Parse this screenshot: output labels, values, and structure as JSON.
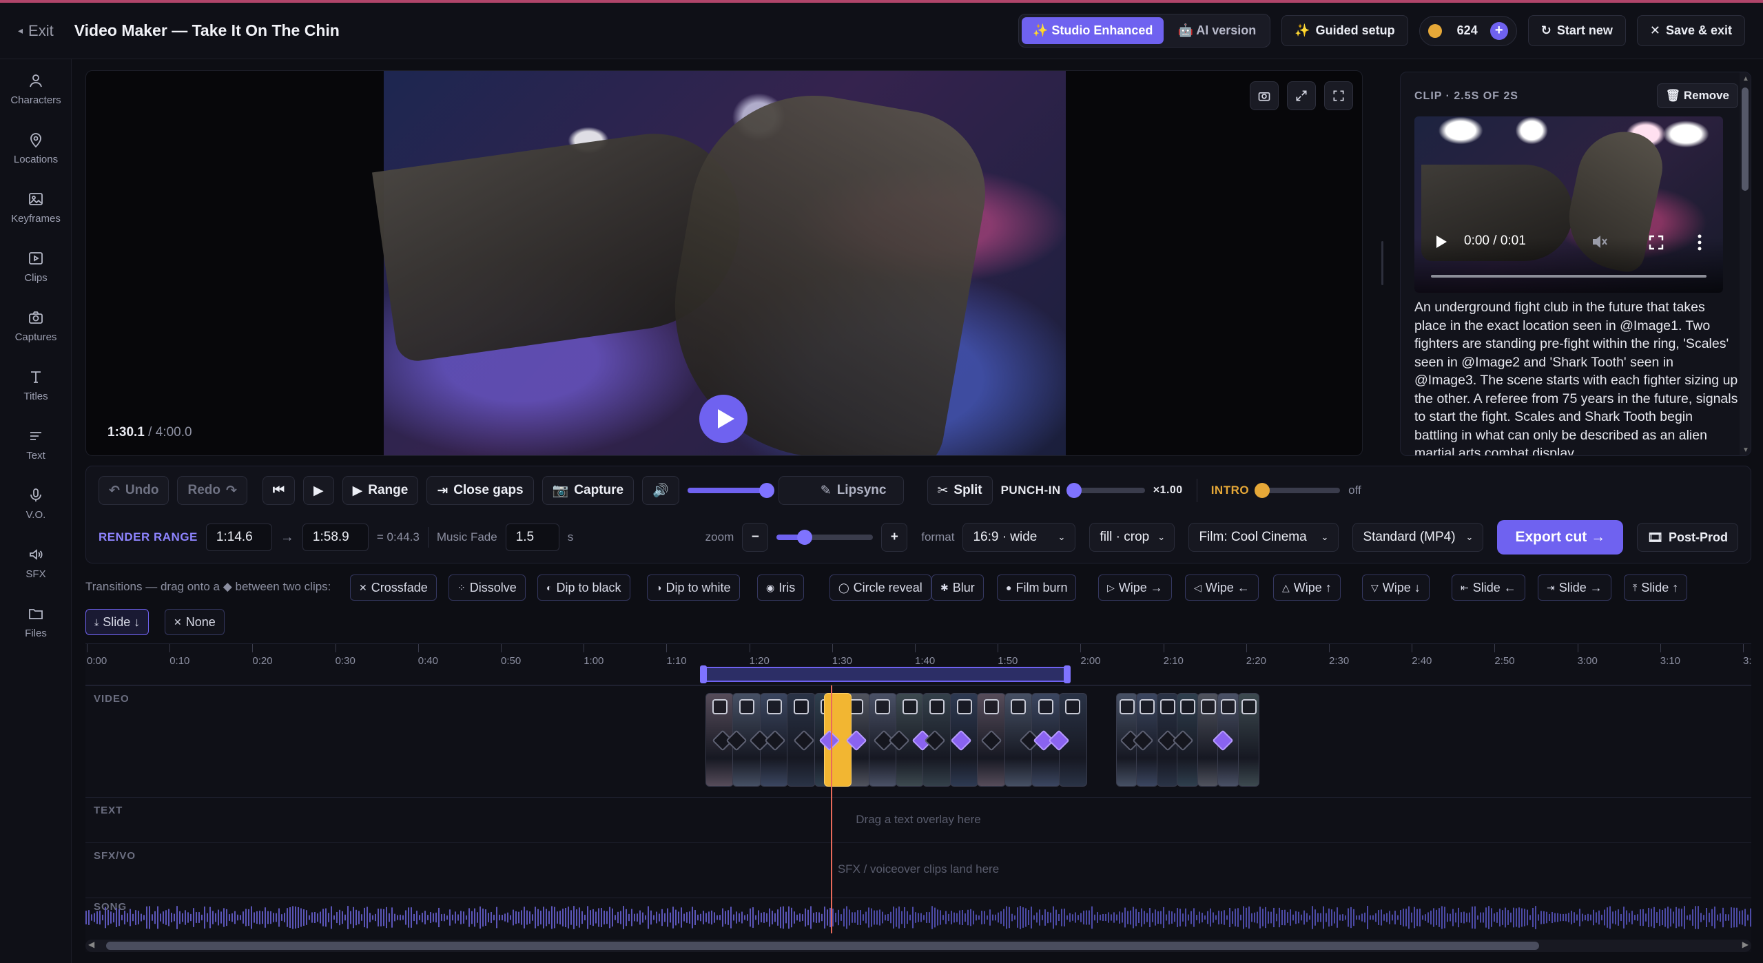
{
  "topbar": {
    "exit_label": "Exit",
    "title": "Video Maker — Take It On The Chin",
    "mode_enhanced": "Studio Enhanced",
    "mode_ai": "AI version",
    "guided_setup": "Guided setup",
    "credits": "624",
    "start_new": "Start new",
    "save_exit": "Save & exit"
  },
  "sidebar": {
    "items": [
      {
        "label": "Characters",
        "icon": "person-icon"
      },
      {
        "label": "Locations",
        "icon": "map-pin-icon"
      },
      {
        "label": "Keyframes",
        "icon": "image-icon"
      },
      {
        "label": "Clips",
        "icon": "play-square-icon"
      },
      {
        "label": "Captures",
        "icon": "camera-icon"
      },
      {
        "label": "Titles",
        "icon": "text-t-icon"
      },
      {
        "label": "Text",
        "icon": "text-lines-icon"
      },
      {
        "label": "V.O.",
        "icon": "microphone-icon"
      },
      {
        "label": "SFX",
        "icon": "speaker-icon"
      },
      {
        "label": "Files",
        "icon": "folder-icon"
      }
    ]
  },
  "preview": {
    "current_time": "1:30.1",
    "separator": " / ",
    "total_time": "4:00.0"
  },
  "clip_panel": {
    "header": "CLIP · 2.5S OF 2S",
    "remove_label": "Remove",
    "player_time": "0:00 / 0:01",
    "description": "An underground fight club in the future that takes place in the exact location seen in @Image1. Two fighters are standing pre-fight within the ring, 'Scales' seen in @Image2 and 'Shark Tooth' seen in @Image3. The scene starts with each fighter sizing up the other. A referee from 75 years in the future, signals to start the fight. Scales and Shark Tooth begin battling in what can only be described as an alien martial arts combat display."
  },
  "toolbar": {
    "undo": "Undo",
    "redo": "Redo",
    "range": "Range",
    "close_gaps": "Close gaps",
    "capture": "Capture",
    "volume": 0.95,
    "lipsync": "Lipsync",
    "split": "Split",
    "punch_in_label": "PUNCH-IN",
    "punch_in_value": "×1.00",
    "intro_label": "INTRO",
    "intro_value": "off",
    "render_range_label": "RENDER RANGE",
    "range_start": "1:14.6",
    "range_end": "1:58.9",
    "range_duration": "= 0:44.3",
    "music_fade_label": "Music Fade",
    "music_fade_value": "1.5",
    "music_fade_unit": "s",
    "zoom_label": "zoom",
    "zoom_minus": "−",
    "zoom_plus": "+",
    "format_label": "format",
    "format_value": "16:9 · wide",
    "fit_value": "fill · crop",
    "film_value": "Film: Cool Cinema",
    "quality_value": "Standard (MP4)",
    "export_label": "Export cut →",
    "postprod_label": "Post-Prod"
  },
  "transitions": {
    "label": "Transitions — drag onto a ◆ between two clips:",
    "items": [
      {
        "icon": "✕",
        "label": "Crossfade"
      },
      {
        "icon": "⁘",
        "label": "Dissolve"
      },
      {
        "icon": "◐",
        "label": "Dip to black"
      },
      {
        "icon": "◑",
        "label": "Dip to white"
      },
      {
        "icon": "◉",
        "label": "Iris"
      },
      {
        "icon": "◯",
        "label": "Circle reveal"
      },
      {
        "icon": "✱",
        "label": "Blur"
      },
      {
        "icon": "●",
        "label": "Film burn"
      },
      {
        "icon": "▷",
        "label": "Wipe →"
      },
      {
        "icon": "◁",
        "label": "Wipe ←"
      },
      {
        "icon": "△",
        "label": "Wipe ↑"
      },
      {
        "icon": "▽",
        "label": "Wipe ↓"
      },
      {
        "icon": "⇤",
        "label": "Slide ←"
      },
      {
        "icon": "⇥",
        "label": "Slide →"
      },
      {
        "icon": "⤒",
        "label": "Slide ↑"
      },
      {
        "icon": "⤓",
        "label": "Slide ↓"
      },
      {
        "icon": "✕",
        "label": "None"
      }
    ]
  },
  "timeline": {
    "ticks": [
      "0:00",
      "0:10",
      "0:20",
      "0:30",
      "0:40",
      "0:50",
      "1:00",
      "1:10",
      "1:20",
      "1:30",
      "1:40",
      "1:50",
      "2:00",
      "2:10",
      "2:20",
      "2:30",
      "2:40",
      "2:50",
      "3:00",
      "3:10",
      "3:"
    ],
    "tracks": {
      "video": "VIDEO",
      "text": "TEXT",
      "text_hint": "Drag a text overlay here",
      "sfx": "SFX/VO",
      "sfx_hint": "SFX / voiceover clips land here",
      "song": "SONG"
    }
  },
  "colors": {
    "accent": "#6f62f0",
    "selected_clip": "#f2b632",
    "playhead": "#e86a5a",
    "transition_diamond": "#8a63f0"
  }
}
